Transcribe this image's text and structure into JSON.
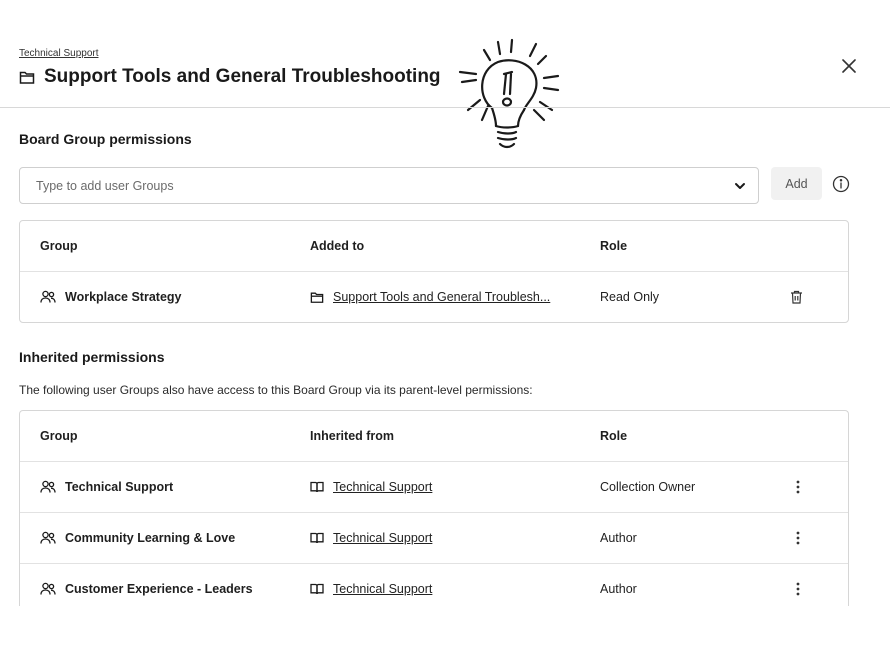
{
  "header": {
    "breadcrumb": "Technical Support",
    "title": "Support Tools and General Troubleshooting",
    "close_icon": "close-icon",
    "title_icon": "folder-icon"
  },
  "board_permissions": {
    "heading": "Board Group permissions",
    "search": {
      "placeholder": "Type to add user Groups",
      "value": ""
    },
    "add_label": "Add",
    "columns": [
      "Group",
      "Added to",
      "Role"
    ],
    "rows": [
      {
        "group": "Workplace Strategy",
        "added_to": "Support Tools and General Troublesh...",
        "role": "Read Only"
      }
    ]
  },
  "inherited_permissions": {
    "heading": "Inherited permissions",
    "description": "The following user Groups also have access to this Board Group via its parent-level permissions:",
    "columns": [
      "Group",
      "Inherited from",
      "Role"
    ],
    "rows": [
      {
        "group": "Technical Support",
        "inherited_from": "Technical Support",
        "role": "Collection Owner"
      },
      {
        "group": "Community Learning & Love",
        "inherited_from": "Technical Support",
        "role": "Author"
      },
      {
        "group": "Customer Experience - Leaders",
        "inherited_from": "Technical Support",
        "role": "Author"
      }
    ]
  },
  "colors": {
    "text": "#1f1f1f",
    "border": "#d6d6d6",
    "add_button_bg": "#f1f1f1"
  }
}
